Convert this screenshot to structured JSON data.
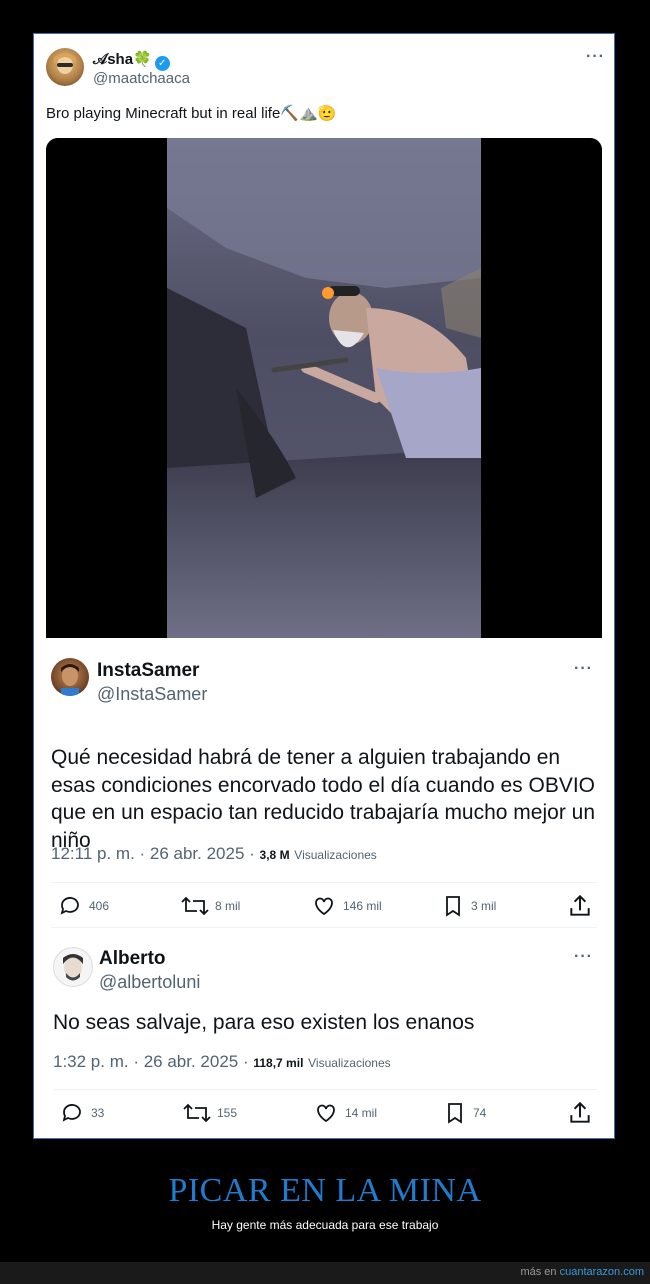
{
  "tweet": {
    "author_name": "𝒜sha🍀",
    "author_handle": "@maatchaaca",
    "more": "···",
    "text": "Bro playing Minecraft but in real life⛏️⛰️🫡"
  },
  "quote1": {
    "name": "InstaSamer",
    "handle": "@InstaSamer",
    "more": "···",
    "text": "Qué necesidad habrá de tener a alguien trabajando en esas condiciones encorvado todo el día cuando es OBVIO que en un espacio tan reducido trabajaría mucho mejor un niño",
    "timestamp": "12:11 p. m. · 26 abr. 2025 ·",
    "views_count": "3,8 M",
    "views_label": "Visualizaciones",
    "replies": "406",
    "reposts": "8 mil",
    "likes": "146 mil",
    "bookmarks": "3 mil"
  },
  "quote2": {
    "name": "Alberto",
    "handle": "@albertoluni",
    "more": "···",
    "text": "No seas salvaje, para eso existen los enanos",
    "timestamp": "1:32 p. m. · 26 abr. 2025 ·",
    "views_count": "118,7 mil",
    "views_label": "Visualizaciones",
    "replies": "33",
    "reposts": "155",
    "likes": "14 mil",
    "bookmarks": "74"
  },
  "caption": {
    "title": "PICAR EN LA MINA",
    "subtitle": "Hay gente más adecuada para ese trabajo"
  },
  "footer": {
    "prefix": "más en",
    "site": "cuantarazon.com"
  },
  "colors": {
    "accent": "#1d9bf0",
    "caption_title": "#1f7ccf",
    "link": "#3a9ad9"
  }
}
